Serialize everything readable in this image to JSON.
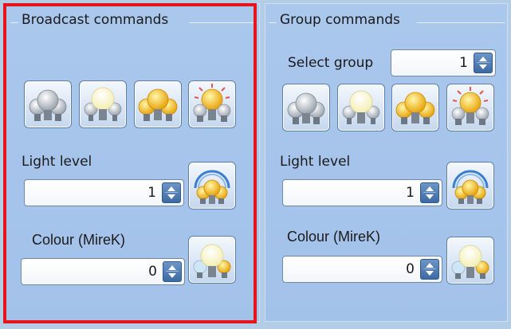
{
  "broadcast": {
    "title": "Broadcast commands",
    "light_level_label": "Light level",
    "light_level_value": "1",
    "colour_label": "Colour (MireK)",
    "colour_value": "0"
  },
  "group": {
    "title": "Group commands",
    "select_group_label": "Select group",
    "select_group_value": "1",
    "light_level_label": "Light level",
    "light_level_value": "1",
    "colour_label": "Colour (MireK)",
    "colour_value": "0"
  },
  "icons": {
    "bulbs_off": "bulbs-off-icon",
    "bulbs_dim": "bulbs-dim-icon",
    "bulbs_on": "bulbs-on-icon",
    "bulbs_flash": "bulbs-flash-icon",
    "light_level": "light-level-dial-icon",
    "colour": "colour-temperature-icon"
  },
  "colors": {
    "panel_bg": "#a9c6ec",
    "highlight": "#e8141b",
    "spinner_button": "#3d6aa3"
  }
}
